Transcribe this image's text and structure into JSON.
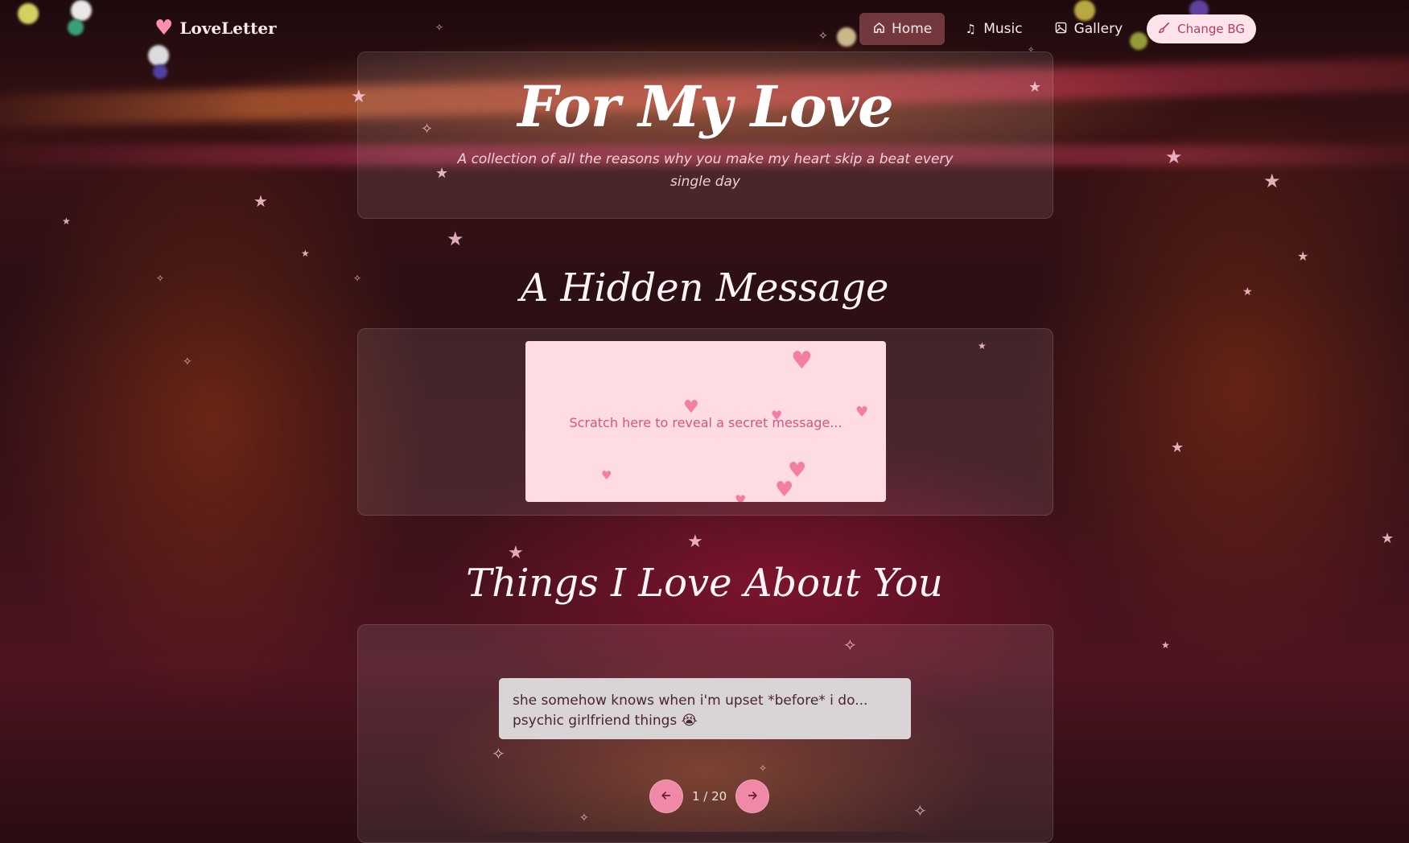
{
  "nav": {
    "brand": "LoveLetter",
    "links": [
      {
        "label": "Home",
        "icon": "home-icon",
        "active": true
      },
      {
        "label": "Music",
        "icon": "music-note-icon",
        "active": false
      },
      {
        "label": "Gallery",
        "icon": "image-icon",
        "active": false
      }
    ],
    "change_bg_label": "Change BG"
  },
  "hero": {
    "title": "For My Love",
    "subtitle": "A collection of all the reasons why you make my heart skip a beat every single day"
  },
  "hidden_message": {
    "title": "A Hidden Message",
    "scratch_text": "Scratch here to reveal a secret message..."
  },
  "things": {
    "title": "Things I Love About You",
    "quote": "she somehow knows when i'm upset *before* i do... psychic girlfriend things 😭",
    "pager": "1 / 20"
  },
  "colors": {
    "accent": "#f089a7",
    "scratch_bg": "#ffdbe3",
    "scratch_text": "#d4567e"
  }
}
